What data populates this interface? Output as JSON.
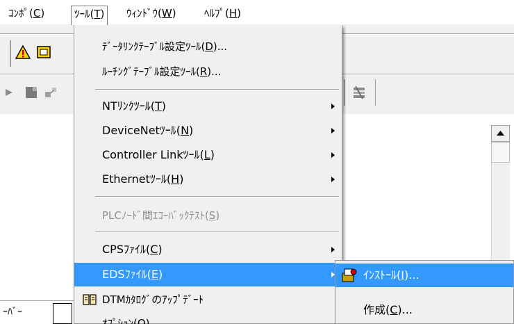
{
  "menubar": {
    "items": [
      {
        "text": "ｺﾝﾎﾟ(",
        "key": "C",
        "close": ")"
      },
      {
        "text": "ﾂｰﾙ(",
        "key": "T",
        "close": ")"
      },
      {
        "text": "ｳｨﾝﾄﾞｳ(",
        "key": "W",
        "close": ")"
      },
      {
        "text": "ﾍﾙﾌﾟ(",
        "key": "H",
        "close": ")"
      }
    ]
  },
  "tools_menu": {
    "items": [
      {
        "pre": "ﾃﾞｰﾀﾘﾝｸﾃｰﾌﾞﾙ設定ﾂｰﾙ(",
        "key": "D",
        "post": ")..."
      },
      {
        "pre": "ﾙｰﾁﾝｸﾞﾃｰﾌﾞﾙ設定ﾂｰﾙ(",
        "key": "R",
        "post": ")..."
      },
      {
        "pre": "NTﾘﾝｸﾂｰﾙ(",
        "key": "T",
        "post": ")"
      },
      {
        "pre": "DeviceNetﾂｰﾙ(",
        "key": "N",
        "post": ")"
      },
      {
        "pre": "Controller Linkﾂｰﾙ(",
        "key": "L",
        "post": ")"
      },
      {
        "pre": "Ethernetﾂｰﾙ(",
        "key": "H",
        "post": ")"
      },
      {
        "pre": "PLCﾉｰﾄﾞ間ｴｺｰﾊﾞｯｸﾃｽﾄ(",
        "key": "S",
        "post": ")"
      },
      {
        "pre": "CPSﾌｧｲﾙ(",
        "key": "C",
        "post": ")"
      },
      {
        "pre": "EDSﾌｧｲﾙ(",
        "key": "E",
        "post": ")"
      },
      {
        "pre": "DTMｶﾀﾛｸﾞのｱｯﾌﾟﾃﾞｰﾄ",
        "key": "",
        "post": ""
      },
      {
        "pre": "ｵﾌﾟｼｮﾝ(",
        "key": "O",
        "post": ")"
      }
    ]
  },
  "eds_submenu": {
    "items": [
      {
        "pre": "ｲﾝｽﾄｰﾙ(",
        "key": "I",
        "post": ")..."
      },
      {
        "pre": "作成(",
        "key": "C",
        "post": ")..."
      }
    ]
  },
  "bottom_fragment": {
    "text": "ｰﾊﾞｰ"
  },
  "colors": {
    "highlight": "#3399ff",
    "menu_bg": "#f0f0f0",
    "disabled_text": "#8d8d8d"
  },
  "icons": [
    "warning-icon",
    "cpu-icon",
    "play-icon",
    "stop-icon",
    "network-icon",
    "tool-icon",
    "book-icon",
    "install-icon"
  ]
}
